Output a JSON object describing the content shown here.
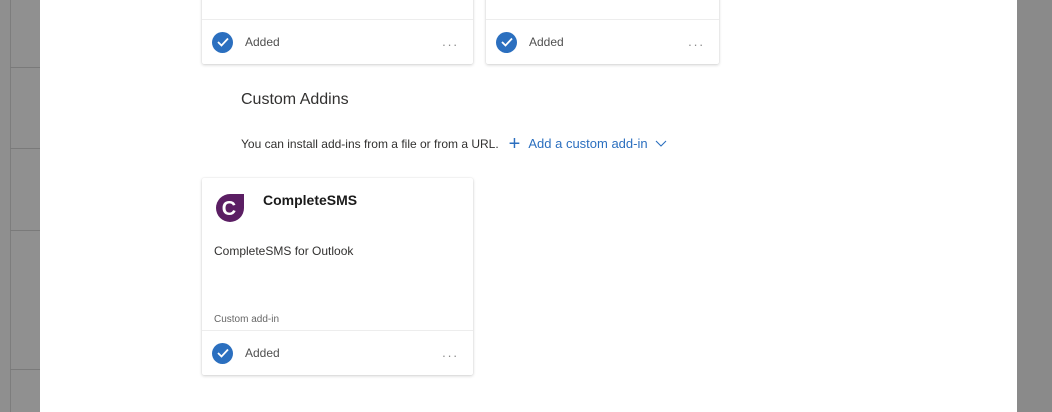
{
  "top_cards": [
    {
      "status": "Added",
      "more": "..."
    },
    {
      "status": "Added",
      "more": "..."
    }
  ],
  "custom_section": {
    "title": "Custom Addins",
    "description": "You can install add-ins from a file or from a URL.",
    "add_link": "Add a custom add-in"
  },
  "custom_card": {
    "name": "CompleteSMS",
    "description": "CompleteSMS for Outlook",
    "type": "Custom add-in",
    "status": "Added",
    "more": "...",
    "logo_letter": "C"
  },
  "colors": {
    "accent": "#2b6fbf",
    "brand_purple": "#5b1e63"
  }
}
